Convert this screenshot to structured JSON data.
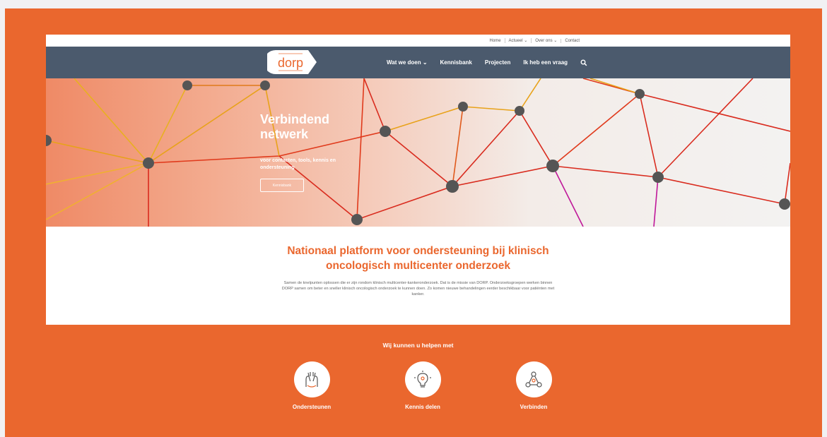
{
  "topbar": {
    "links": [
      "Home",
      "Actueel ⌄",
      "Over ons ⌄",
      "Contact"
    ]
  },
  "nav": {
    "logo_text": "dorp",
    "links": [
      "Wat we doen ⌄",
      "Kennisbank",
      "Projecten",
      "Ik heb een vraag"
    ],
    "search_icon": "search-icon"
  },
  "hero": {
    "title": "Verbindend netwerk",
    "subtitle": "voor contacten, tools, kennis en ondersteuning",
    "button": "Kennisbank"
  },
  "intro": {
    "heading": "Nationaal platform voor ondersteuning bij klinisch oncologisch multicenter onderzoek",
    "body": "Samen de knelpunten oplossen die er zijn rondom klinisch multicenter-kankeronderzoek. Dat is de missie van DORP. Onderzoeksgroepen werken binnen DORP samen om beter en sneller klinisch oncologisch onderzoek te kunnen doen. Zo komen nieuwe behandelingen eerder beschikbaar voor patiënten met kanker."
  },
  "help": {
    "title": "Wij kunnen u helpen met",
    "items": [
      {
        "label": "Ondersteunen",
        "icon": "hands-icon"
      },
      {
        "label": "Kennis delen",
        "icon": "lightbulb-icon"
      },
      {
        "label": "Verbinden",
        "icon": "network-icon"
      }
    ]
  },
  "colors": {
    "accent": "#ea672e",
    "nav": "#4b5a6d",
    "background": "#f1f1f3"
  }
}
